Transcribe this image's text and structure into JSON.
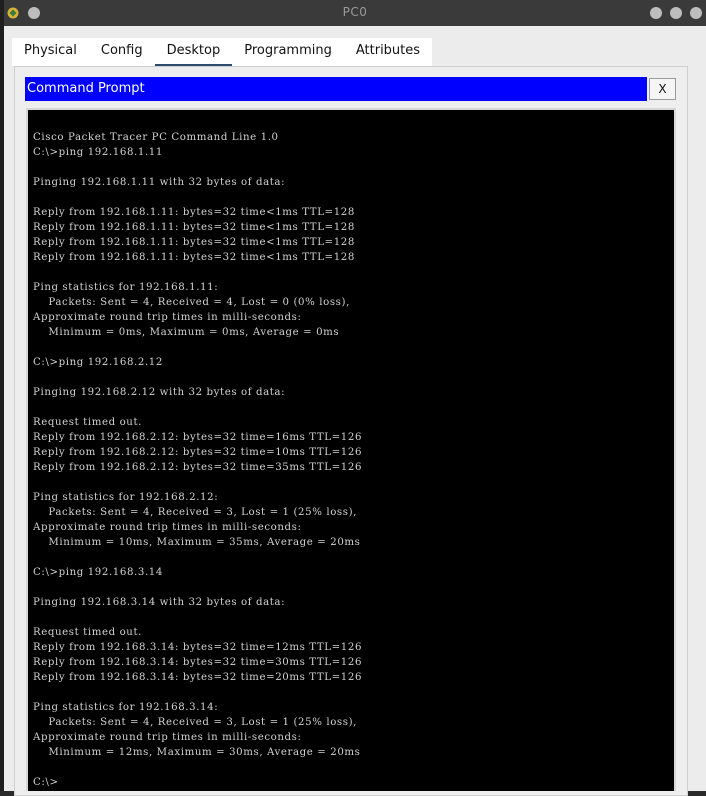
{
  "window": {
    "title": "PC0"
  },
  "tabs": [
    {
      "label": "Physical"
    },
    {
      "label": "Config"
    },
    {
      "label": "Desktop"
    },
    {
      "label": "Programming"
    },
    {
      "label": "Attributes"
    }
  ],
  "command_prompt": {
    "header": "Command Prompt",
    "close_label": "X",
    "output": "Cisco Packet Tracer PC Command Line 1.0\nC:\\>ping 192.168.1.11\n\nPinging 192.168.1.11 with 32 bytes of data:\n\nReply from 192.168.1.11: bytes=32 time<1ms TTL=128\nReply from 192.168.1.11: bytes=32 time<1ms TTL=128\nReply from 192.168.1.11: bytes=32 time<1ms TTL=128\nReply from 192.168.1.11: bytes=32 time<1ms TTL=128\n\nPing statistics for 192.168.1.11:\n    Packets: Sent = 4, Received = 4, Lost = 0 (0% loss),\nApproximate round trip times in milli-seconds:\n    Minimum = 0ms, Maximum = 0ms, Average = 0ms\n\nC:\\>ping 192.168.2.12\n\nPinging 192.168.2.12 with 32 bytes of data:\n\nRequest timed out.\nReply from 192.168.2.12: bytes=32 time=16ms TTL=126\nReply from 192.168.2.12: bytes=32 time=10ms TTL=126\nReply from 192.168.2.12: bytes=32 time=35ms TTL=126\n\nPing statistics for 192.168.2.12:\n    Packets: Sent = 4, Received = 3, Lost = 1 (25% loss),\nApproximate round trip times in milli-seconds:\n    Minimum = 10ms, Maximum = 35ms, Average = 20ms\n\nC:\\>ping 192.168.3.14\n\nPinging 192.168.3.14 with 32 bytes of data:\n\nRequest timed out.\nReply from 192.168.3.14: bytes=32 time=12ms TTL=126\nReply from 192.168.3.14: bytes=32 time=30ms TTL=126\nReply from 192.168.3.14: bytes=32 time=20ms TTL=126\n\nPing statistics for 192.168.3.14:\n    Packets: Sent = 4, Received = 3, Lost = 1 (25% loss),\nApproximate round trip times in milli-seconds:\n    Minimum = 12ms, Maximum = 30ms, Average = 20ms\n\nC:\\>"
  },
  "colors": {
    "header_bg": "#0000ff",
    "terminal_bg": "#000000",
    "terminal_fg": "#d2d2d2",
    "active_tab_underline": "#2c4a6e"
  },
  "icons": {
    "app": "packet-tracer-app-icon"
  }
}
